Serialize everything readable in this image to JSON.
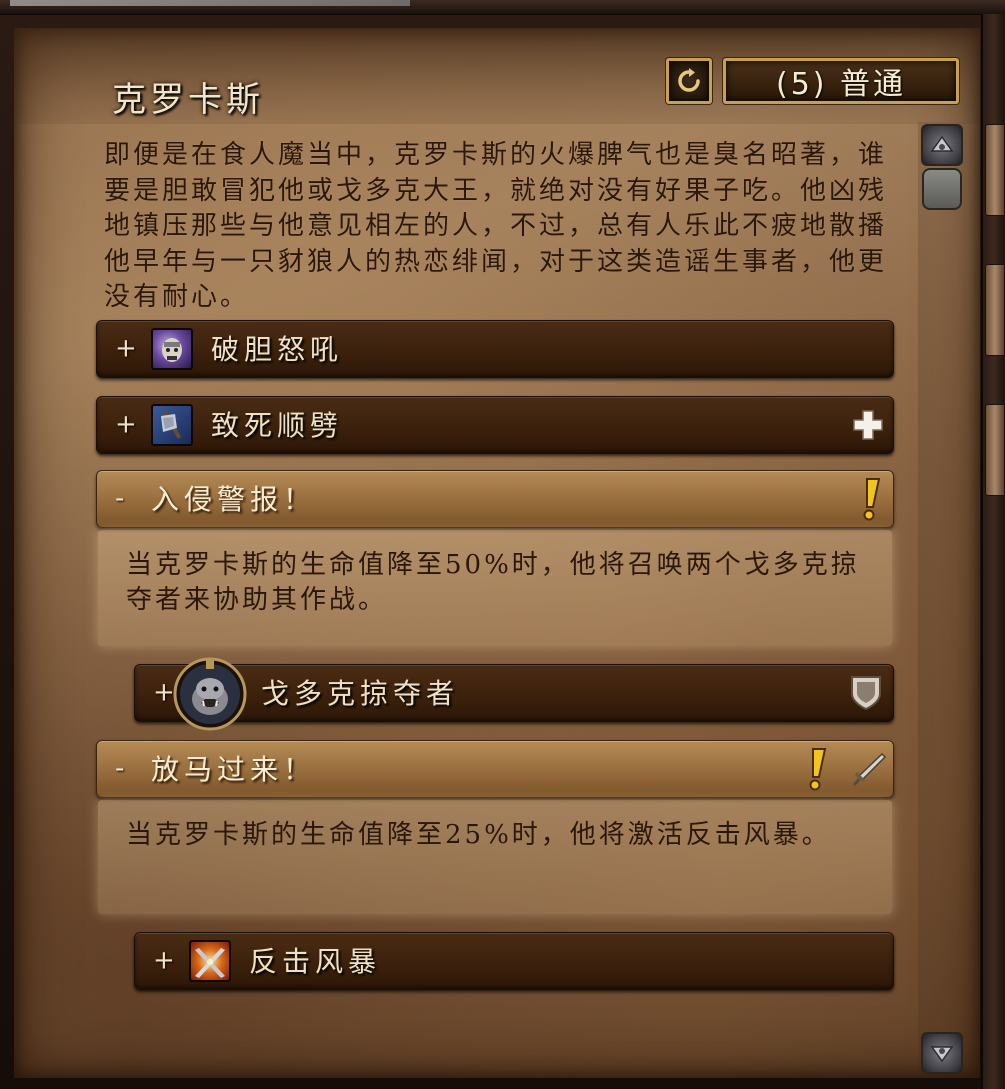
{
  "header": {
    "title": "克罗卡斯",
    "reset_icon": "reset-arrow-icon",
    "difficulty_label": "(5) 普通"
  },
  "lore": "即便是在食人魔当中，克罗卡斯的火爆脾气也是臭名昭著，谁要是胆敢冒犯他或戈多克大王，就绝对没有好果子吃。他凶残地镇压那些与他意见相左的人，不过，总有人乐此不疲地散播他早年与一只豺狼人的热恋绯闻，对于这类造谣生事者，他更没有耐心。",
  "sections": [
    {
      "sign": "+",
      "label": "破胆怒吼",
      "icon": "intimidating-shout-icon"
    },
    {
      "sign": "+",
      "label": "致死顺劈",
      "icon": "mortal-cleave-icon",
      "flag": "healer-cross-icon"
    },
    {
      "sign": "-",
      "label": "入侵警报！",
      "icon": null,
      "flag": "important-exclamation-icon",
      "description": "当克罗卡斯的生命值降至50%时，他将召唤两个戈多克掠夺者来协助其作战。"
    },
    {
      "sign": "+",
      "label": "戈多克掠夺者",
      "icon": "ogre-portrait-icon",
      "flag": "tank-shield-icon"
    },
    {
      "sign": "-",
      "label": "放马过来！",
      "icon": null,
      "flags": [
        "important-exclamation-icon",
        "dps-sword-icon"
      ],
      "description": "当克罗卡斯的生命值降至25%时，他将激活反击风暴。"
    },
    {
      "sign": "+",
      "label": "反击风暴",
      "icon": "counterstorm-icon"
    }
  ],
  "colors": {
    "parchment": "#9a7652",
    "bar_dark": "#3a200c",
    "bar_expanded": "#9a7040",
    "button_border": "#c8a050",
    "lore_text": "#2a170a",
    "title_text": "#f2e6c8"
  }
}
